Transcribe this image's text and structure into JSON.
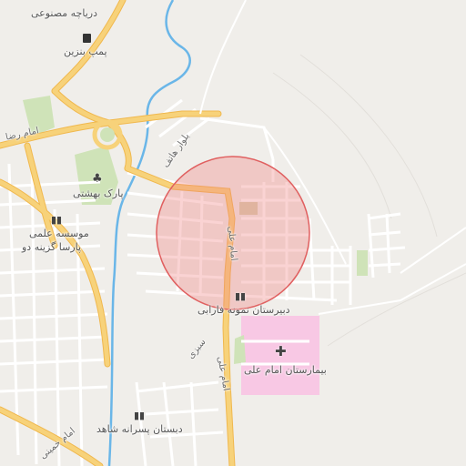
{
  "map": {
    "labels": {
      "darya_label": "دریاچه مصنوعی",
      "fuel_label": "پمپ بنزین",
      "park_label": "پارک بهشتی",
      "institute_line1": "موسسه علمی",
      "institute_line2": "پارسا گزینه دو",
      "school_farabi": "دبیرستان نمونه فارابی",
      "hospital": "بیمارستان امام علی",
      "school_shahed": "دبستان پسرانه شاهد",
      "street_imam_reza": "امام رضا",
      "street_imam_ali_1": "امام علی",
      "street_imam_ali_2": "امام علی",
      "street_hatef": "بلوار هاتف",
      "street_sabri": "سبزی",
      "street_imam_khomeini": "امام خمینی"
    },
    "colors": {
      "background": "#f0eeea",
      "major_road": "#f7d27a",
      "minor_road": "#ffffff",
      "water": "#6ab6e8",
      "park": "#cfe3b8",
      "hospital_area": "#f8c8e4",
      "highlight_circle": "#f08080"
    },
    "icons": {
      "fuel": "fuel-pump-icon",
      "park": "tree-icon",
      "school": "school-icon",
      "hospital": "hospital-cross-icon"
    }
  }
}
